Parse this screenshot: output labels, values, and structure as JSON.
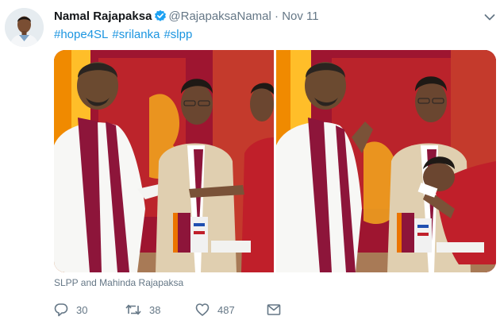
{
  "tweet": {
    "display_name": "Namal Rajapaksa",
    "handle": "@RajapaksaNamal",
    "separator": "·",
    "date": "Nov 11",
    "hashtags": [
      "#hope4SL",
      "#srilanka",
      "#slpp"
    ],
    "media_caption": "SLPP and Mahinda Rajapaksa"
  },
  "actions": {
    "replies": "30",
    "retweets": "38",
    "likes": "487"
  },
  "colors": {
    "link": "#1b95e0",
    "verified": "#1da1f2",
    "muted": "#657786",
    "flag_maroon": "#8d153a",
    "flag_orange": "#eb7400",
    "flag_gold": "#ffbe29"
  },
  "icons": [
    "verified-badge-icon",
    "chevron-down-icon",
    "reply-icon",
    "retweet-icon",
    "like-icon",
    "direct-message-icon"
  ]
}
